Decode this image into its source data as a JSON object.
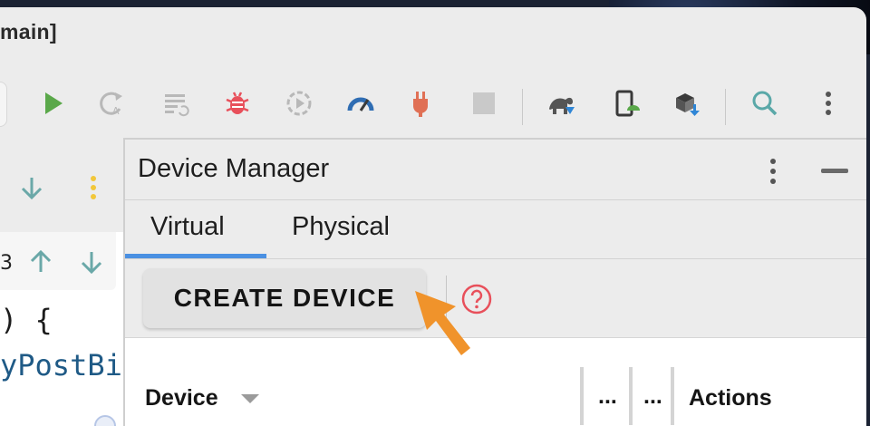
{
  "window": {
    "title": "main]"
  },
  "toolbar": {
    "icons": [
      "run-icon",
      "apply-changes-icon",
      "apply-code-changes-icon",
      "debug-icon",
      "attach-debugger-icon",
      "profile-icon",
      "plug-icon",
      "stop-icon",
      "gradle-sync-icon",
      "device-manager-icon",
      "sdk-manager-icon",
      "search-icon",
      "more-icon"
    ]
  },
  "editor": {
    "find_text": "3",
    "code_line_1": ") {",
    "code_line_2": "yPostBi"
  },
  "device_manager": {
    "title": "Device Manager",
    "tabs": [
      {
        "label": "Virtual",
        "active": true
      },
      {
        "label": "Physical",
        "active": false
      }
    ],
    "create_button": "CREATE DEVICE",
    "table": {
      "headers": {
        "device": "Device",
        "col2": "...",
        "col3": "...",
        "actions": "Actions"
      }
    }
  },
  "colors": {
    "accent_tab": "#4a90e2",
    "pointer": "#f0932b",
    "help": "#e8505b",
    "run": "#5aa84a",
    "debug": "#e8505b"
  }
}
